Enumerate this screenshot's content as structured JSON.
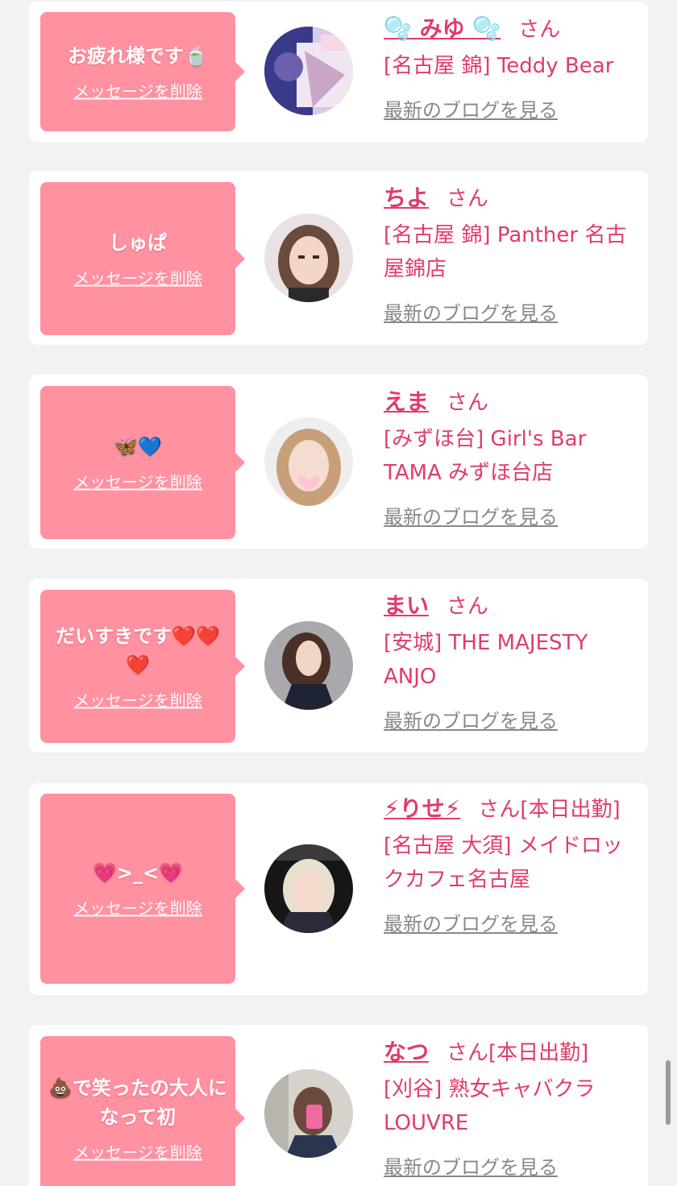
{
  "delete_label": "メッセージを削除",
  "blog_label": "最新のブログを見る",
  "san_label": "さん",
  "colors": {
    "accent": "#e03c6a",
    "bubble": "#ff91a0",
    "background": "#f2f2f2"
  },
  "items": [
    {
      "message": "お疲れ様です🍵",
      "name": "🫧 みゆ 🫧",
      "suffix": "さん",
      "shop": "[名古屋 錦] Teddy Bear"
    },
    {
      "message": "しゅぱ",
      "name": "ちよ",
      "suffix": "さん",
      "shop": "[名古屋 錦] Panther 名古屋錦店"
    },
    {
      "message": "🦋💙",
      "name": "えま",
      "suffix": "さん",
      "shop": "[みずほ台] Girl's Bar TAMA みずほ台店"
    },
    {
      "message": "だいすきです❤️❤️❤️",
      "name": "まい",
      "suffix": "さん",
      "shop": "[安城] THE MAJESTY ANJO"
    },
    {
      "message": "💗>_<💗",
      "name": "⚡りせ⚡",
      "suffix": "さん[本日出勤]",
      "shop": "[名古屋 大須] メイドロックカフェ名古屋"
    },
    {
      "message": "💩で笑ったの大人になって初",
      "name": "なつ",
      "suffix": "さん[本日出勤]",
      "shop": "[刈谷] 熟女キャバクラ LOUVRE"
    }
  ]
}
